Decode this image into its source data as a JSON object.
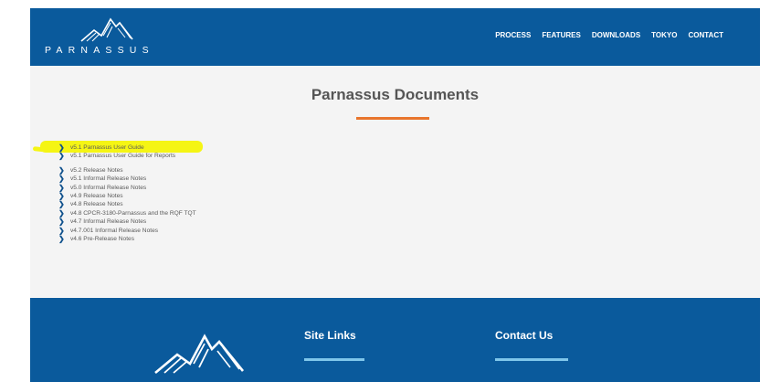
{
  "header": {
    "logo_text": "PARNASSUS",
    "nav": [
      "PROCESS",
      "FEATURES",
      "DOWNLOADS",
      "TOKYO",
      "CONTACT"
    ]
  },
  "main": {
    "title": "Parnassus Documents",
    "documents": [
      "v5.1 Parnassus User Guide",
      "v5.1 Parnassus User Guide for Reports",
      "v5.2 Release Notes",
      "v5.1 Informal Release Notes",
      "v5.0 Informal Release Notes",
      "v4.9 Release Notes",
      "v4.8 Release Notes",
      "v4.8 CPCR-3180-Parnassus and the RQF TQT",
      "v4.7 Informal Release Notes",
      "v4.7.001 Informal Release Notes",
      "v4.6 Pre-Release Notes"
    ]
  },
  "footer": {
    "site_links_heading": "Site Links",
    "contact_heading": "Contact Us"
  },
  "colors": {
    "brand_blue": "#0a5a9c",
    "accent_orange": "#e8752c",
    "highlight_yellow": "#f5f514",
    "rule_light_blue": "#7fc6ea"
  }
}
